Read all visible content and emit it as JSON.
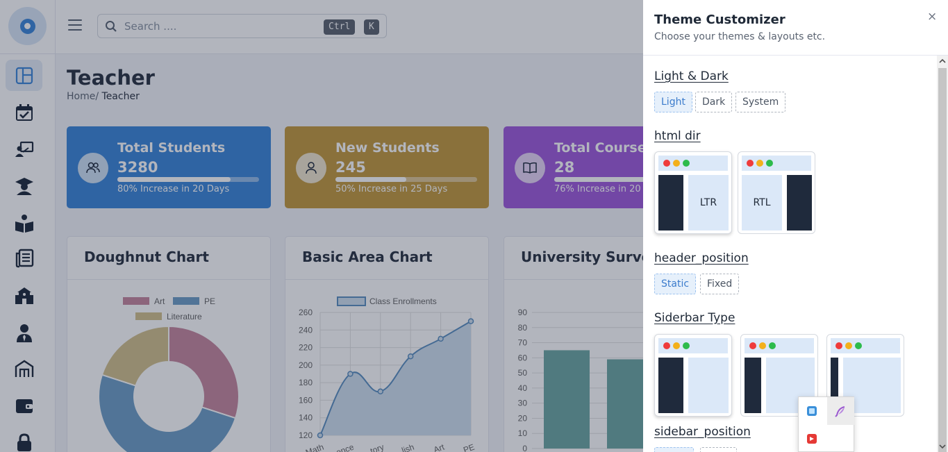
{
  "header": {
    "search_placeholder": "Search ....",
    "kbd_ctrl": "Ctrl",
    "kbd_k": "K"
  },
  "sidebar": {
    "items": [
      "dashboard",
      "events",
      "teachers",
      "students",
      "courses",
      "library",
      "school",
      "staff",
      "departments",
      "payments",
      "lock"
    ]
  },
  "page": {
    "title": "Teacher",
    "breadcrumb_home": "Home/",
    "breadcrumb_current": "Teacher"
  },
  "stats": [
    {
      "title": "Total Students",
      "value": "3280",
      "note": "80% Increase in 20 Days",
      "progress": 0.8,
      "color": "#3d87d8",
      "icon": "users-icon"
    },
    {
      "title": "New Students",
      "value": "245",
      "note": "50% Increase in 25 Days",
      "progress": 0.5,
      "color": "#c49a3e",
      "icon": "user-icon"
    },
    {
      "title": "Total Course",
      "value": "28",
      "note": "76% Increase in 20",
      "progress": 0.76,
      "color": "#a05cdb",
      "icon": "book-icon"
    }
  ],
  "cards": {
    "doughnut_title": "Doughnut Chart",
    "area_title": "Basic Area Chart",
    "survey_title": "University Survey"
  },
  "chart_data": [
    {
      "type": "pie",
      "title": "Doughnut Chart",
      "legend_placement": "top",
      "categories": [
        "Art",
        "PE",
        "Literature"
      ],
      "values": [
        30,
        50,
        20
      ],
      "colors": [
        "#c7889f",
        "#6f9fc6",
        "#d2c08c"
      ]
    },
    {
      "type": "area",
      "title": "Basic Area Chart",
      "legend": "Class Enrollments",
      "categories": [
        "Math",
        "Science",
        "History",
        "English",
        "Art",
        "PE"
      ],
      "values": [
        120,
        190,
        170,
        210,
        230,
        250
      ],
      "ylim": [
        120,
        260
      ],
      "yticks": [
        120,
        140,
        160,
        180,
        200,
        220,
        240,
        260
      ],
      "xtick_labels": [
        "Math",
        "ence",
        "tory",
        "lish",
        "Art",
        "PE"
      ],
      "color": "#5b8fc0",
      "grid": true
    },
    {
      "type": "bar",
      "title": "University Survey",
      "values": [
        65,
        59
      ],
      "ylim": [
        0,
        90
      ],
      "yticks": [
        0,
        10,
        20,
        30,
        40,
        50,
        60,
        70,
        80,
        90
      ],
      "color": "#6da7a3",
      "grid": true
    }
  ],
  "customizer": {
    "title": "Theme Customizer",
    "subtitle": "Choose your themes & layouts etc.",
    "close": "×",
    "light_dark": {
      "label": "Light & Dark",
      "options": [
        "Light",
        "Dark",
        "System"
      ],
      "selected": "Light"
    },
    "html_dir": {
      "label": "html dir",
      "options": [
        "LTR",
        "RTL"
      ],
      "selected": "LTR"
    },
    "header_position": {
      "label": "header_position",
      "options": [
        "Static",
        "Fixed"
      ],
      "selected": "Static"
    },
    "sidebar_type": {
      "label": "Siderbar Type"
    },
    "sidebar_position": {
      "label": "sidebar_position"
    }
  }
}
